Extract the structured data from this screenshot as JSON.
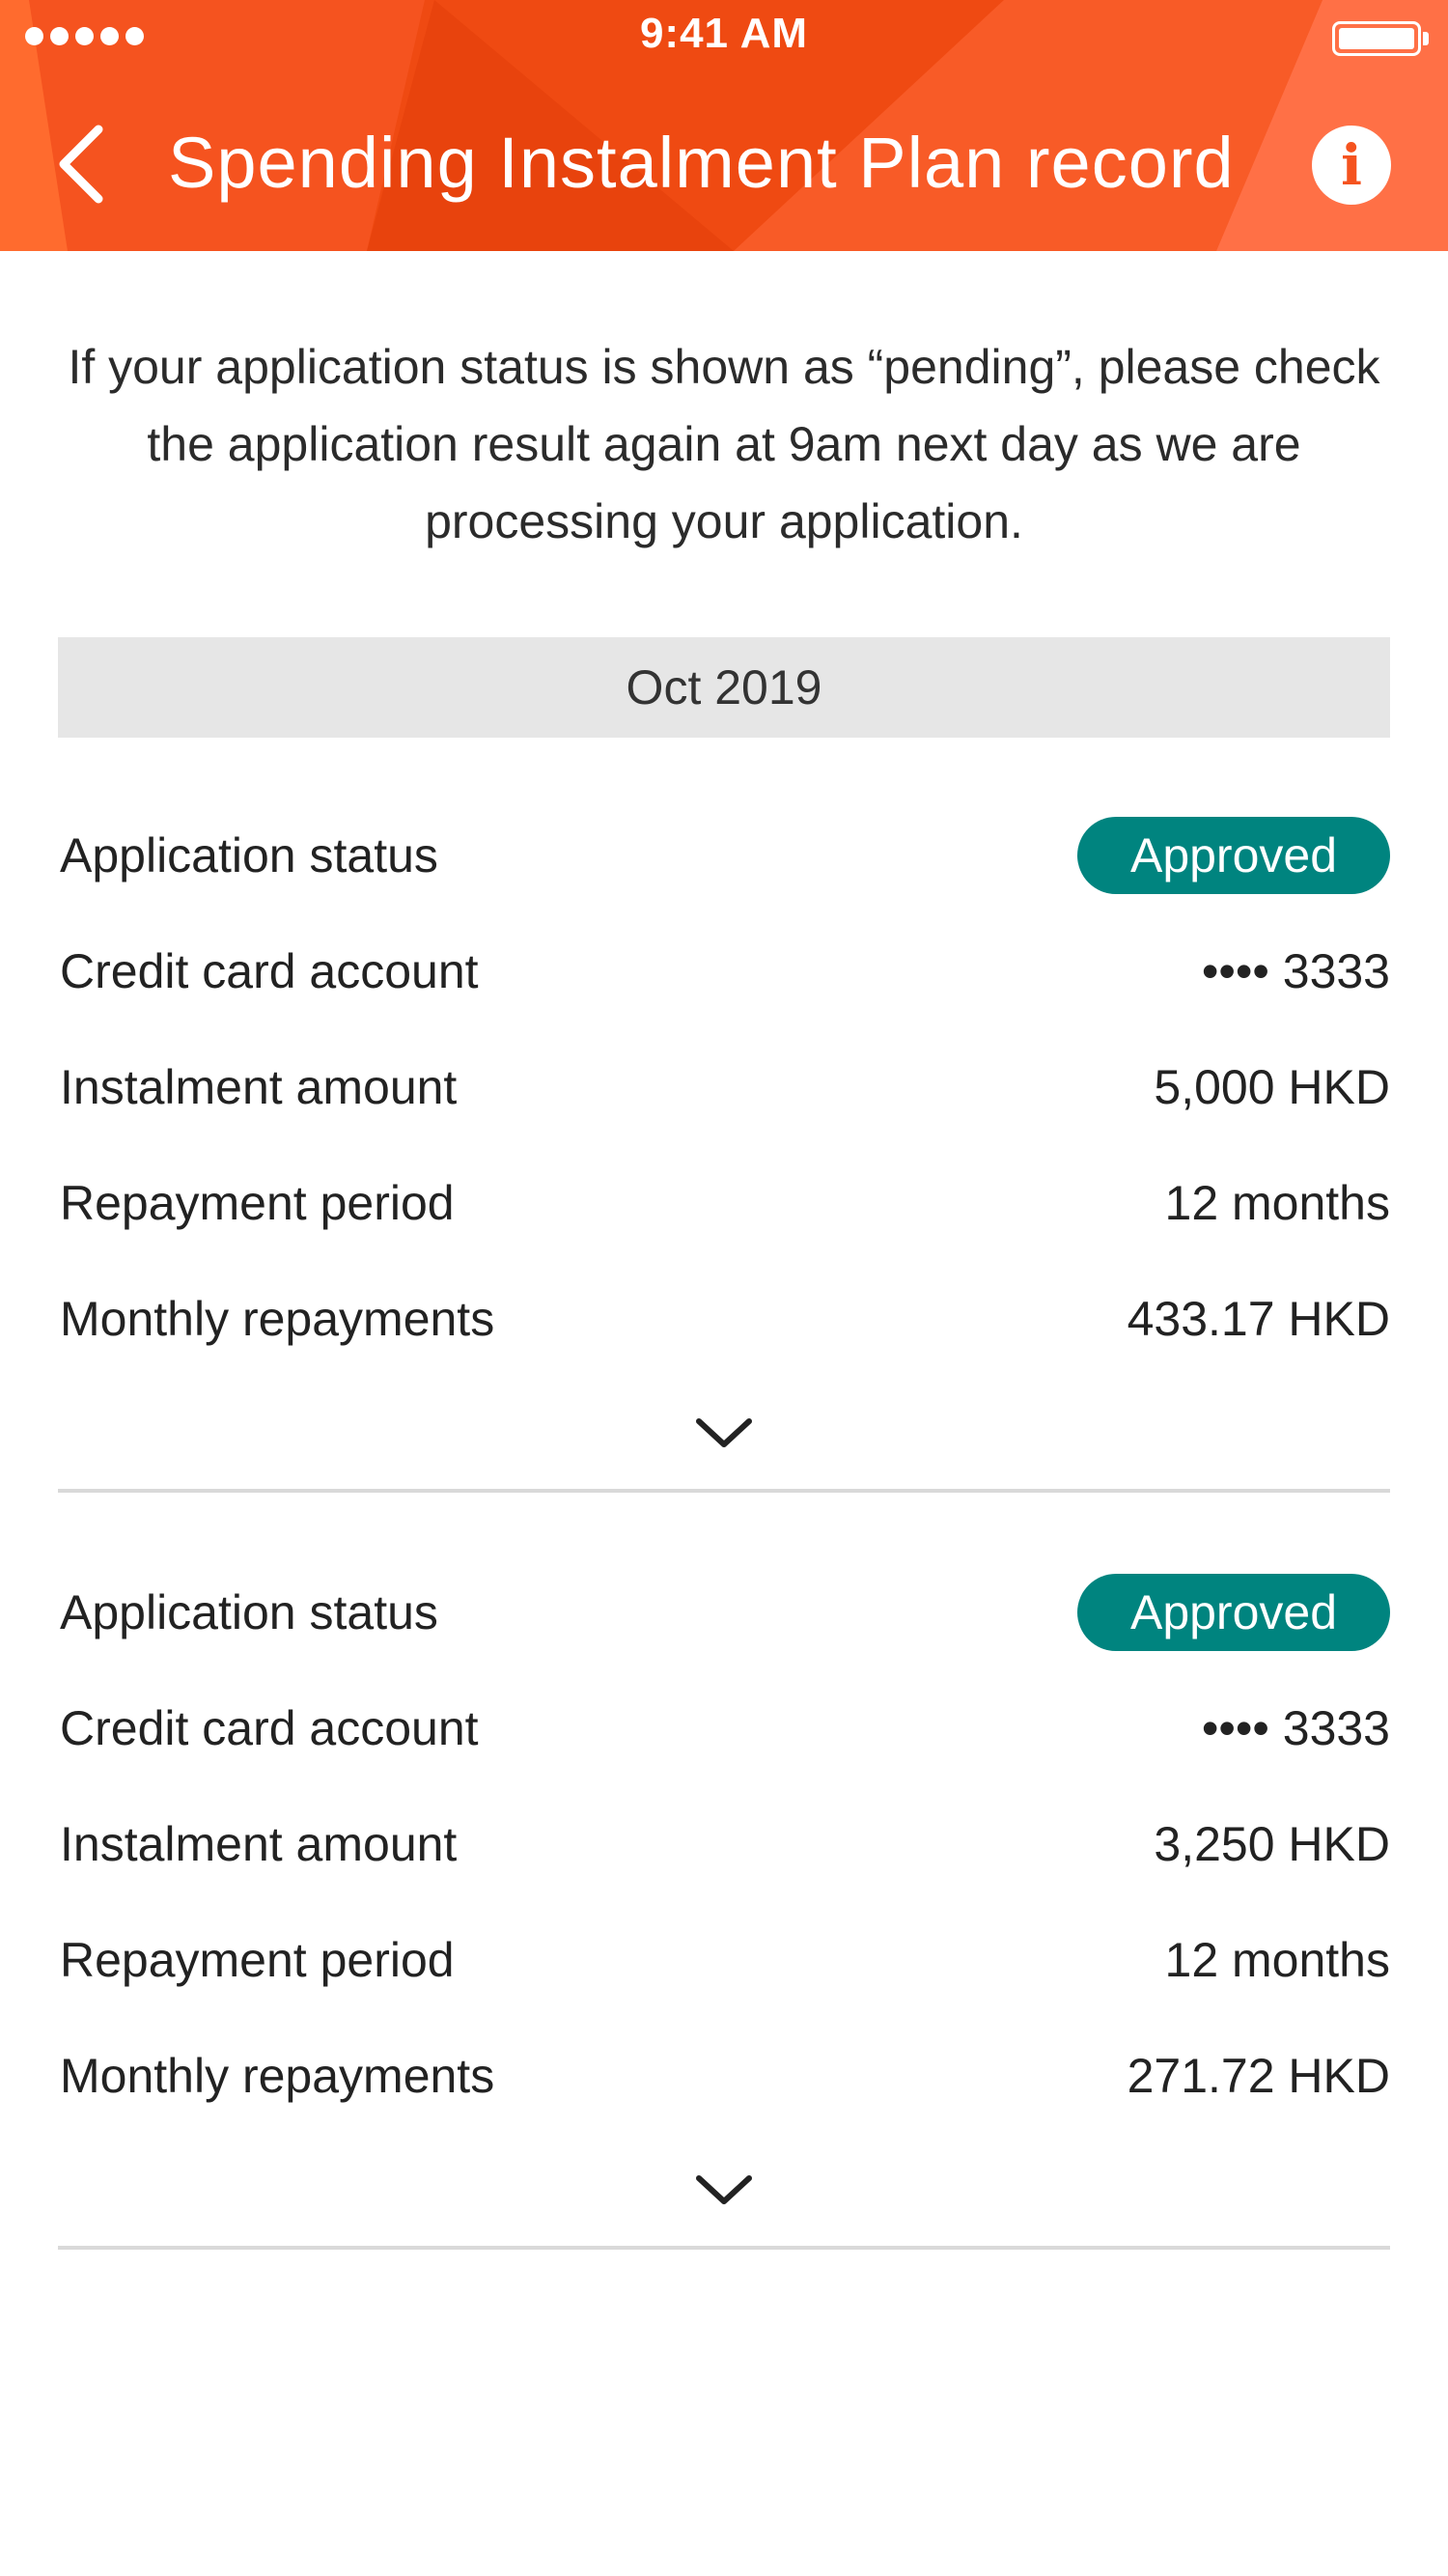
{
  "status_bar": {
    "time": "9:41 AM"
  },
  "header": {
    "title": "Spending Instalment Plan record",
    "back_icon": "chevron-left-icon",
    "info_icon": "info-icon",
    "info_glyph": "i"
  },
  "notice": {
    "text": "If your application status is shown as “pending”, please check the application result again at 9am next day as we are processing your application."
  },
  "month": {
    "label": "Oct 2019"
  },
  "records": [
    {
      "status_label": "Application status",
      "status_value": "Approved",
      "card_label": "Credit card account",
      "card_value": "•••• 3333",
      "amount_label": "Instalment amount",
      "amount_value": "5,000 HKD",
      "period_label": "Repayment period",
      "period_value": "12 months",
      "monthly_label": "Monthly repayments",
      "monthly_value": "433.17 HKD"
    },
    {
      "status_label": "Application status",
      "status_value": "Approved",
      "card_label": "Credit card account",
      "card_value": "•••• 3333",
      "amount_label": "Instalment amount",
      "amount_value": "3,250 HKD",
      "period_label": "Repayment period",
      "period_value": "12 months",
      "monthly_label": "Monthly repayments",
      "monthly_value": "271.72 HKD"
    }
  ],
  "colors": {
    "header_primary": "#f5531f",
    "header_dark": "#e43f10",
    "header_light": "#ff6b3a",
    "badge_approved": "#00847f",
    "month_band": "#e6e6e6",
    "divider": "#d9d9d9"
  }
}
